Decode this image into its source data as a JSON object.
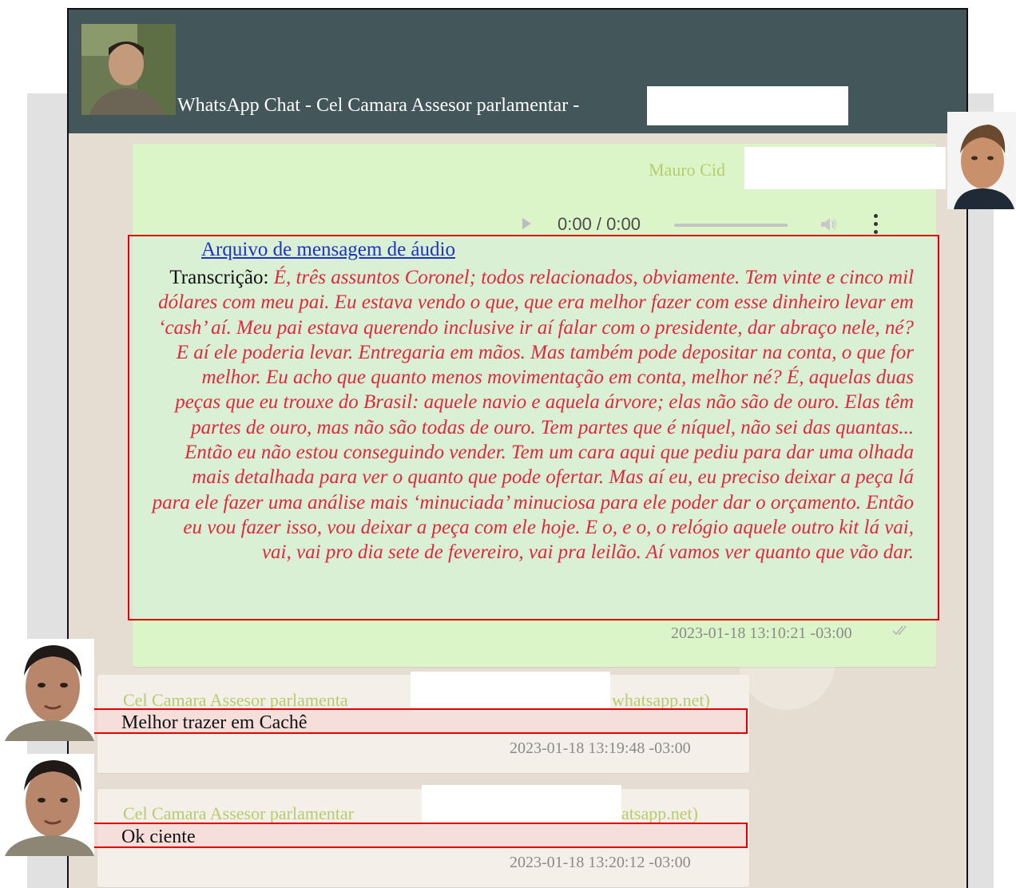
{
  "header": {
    "title": "WhatsApp Chat - Cel Camara Assesor parlamentar -"
  },
  "messages": {
    "outgoing": {
      "sender": "Mauro Cid",
      "audio": {
        "time": "0:00 / 0:00"
      },
      "link_text": "Arquivo de mensagem de áudio",
      "transcript_label": "Transcrição:",
      "transcript": "É, três assuntos Coronel; todos relacionados, obviamente. Tem vinte e cinco mil dólares com meu pai. Eu estava vendo o que, que era melhor fazer com esse dinheiro levar em ‘cash’ aí. Meu pai estava querendo inclusive ir aí falar com o presidente, dar abraço nele, né? E aí ele poderia levar. Entregaria em mãos. Mas também pode depositar na conta, o que for melhor. Eu acho que quanto menos movimentação em conta, melhor né? É, aquelas duas peças que eu trouxe do Brasil: aquele navio e aquela árvore; elas não são de ouro. Elas têm partes de ouro, mas não são todas de ouro. Tem partes que é níquel, não sei das quantas... Então eu não estou conseguindo vender. Tem um cara aqui que pediu para dar uma olhada mais detalhada para ver o quanto que pode ofertar. Mas aí eu, eu preciso deixar a peça lá para ele fazer uma análise mais ‘minuciada’ minuciosa para ele poder dar o orçamento. Então eu vou fazer isso, vou deixar a peça com ele hoje. E o, e o, o relógio aquele outro kit lá vai, vai, vai pro dia sete de fevereiro, vai pra leilão. Aí vamos ver quanto que vão dar.",
      "timestamp": "2023-01-18 13:10:21 -03:00"
    },
    "incoming": [
      {
        "sender": "Cel Camara Assesor parlamenta",
        "sender_suffix": "whatsapp.net)",
        "text": "Melhor trazer em Cachê",
        "timestamp": "2023-01-18 13:19:48 -03:00"
      },
      {
        "sender": "Cel Camara Assesor parlamentar",
        "sender_suffix": "atsapp.net)",
        "text": "Ok ciente",
        "timestamp": "2023-01-18 13:20:12 -03:00"
      }
    ]
  },
  "colors": {
    "header": "#43565a",
    "outgoing_bubble": "#dcf5c8",
    "incoming_bubble": "#f4efe9",
    "sender_name": "#b7cc6c",
    "transcript": "#e0283e",
    "highlight_border": "#e00000",
    "link": "#1e32c8"
  },
  "icons": [
    "contact-photo",
    "user-photo",
    "sender-photo",
    "play-icon",
    "volume-icon",
    "more-options-icon",
    "double-check-icon"
  ]
}
